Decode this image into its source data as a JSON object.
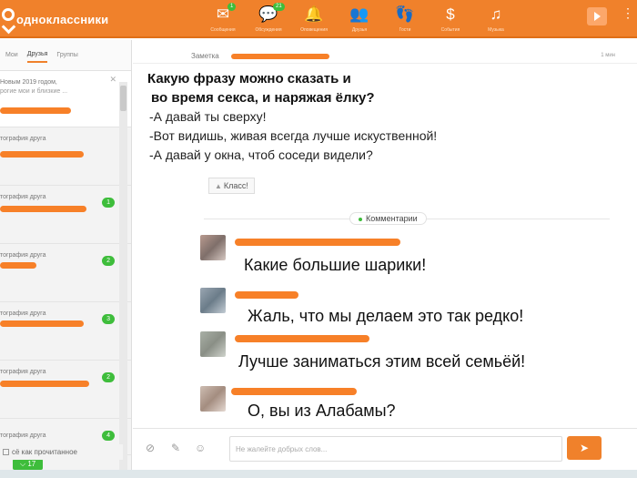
{
  "app": {
    "logo_text": "одноклассники"
  },
  "nav": [
    {
      "label": "Сообщения",
      "icon": "✉",
      "badge": "1"
    },
    {
      "label": "Обсуждения",
      "icon": "💬",
      "badge": "21"
    },
    {
      "label": "Оповещения",
      "icon": "🔔",
      "badge": ""
    },
    {
      "label": "Друзья",
      "icon": "👥",
      "badge": ""
    },
    {
      "label": "Гости",
      "icon": "👣",
      "badge": ""
    },
    {
      "label": "События",
      "icon": "$",
      "badge": ""
    },
    {
      "label": "Музыка",
      "icon": "♫",
      "badge": ""
    }
  ],
  "sidebar": {
    "tabs": [
      "Мои",
      "Друзья",
      "Группы"
    ],
    "items": [
      {
        "title": "Новым 2019 годом,",
        "sub": "рогие мои и близкие ...",
        "badge": ""
      },
      {
        "title": "тография друга",
        "sub": "",
        "badge": ""
      },
      {
        "title": "тография друга",
        "sub": "",
        "badge": "1"
      },
      {
        "title": "тография друга",
        "sub": "",
        "badge": "2"
      },
      {
        "title": "тография друга",
        "sub": "",
        "badge": "3"
      },
      {
        "title": "тография друга",
        "sub": "",
        "badge": "2"
      },
      {
        "title": "тография друга",
        "sub": "",
        "badge": "4"
      }
    ],
    "unread_label": "17",
    "footer_label": "сё как прочитанное"
  },
  "note": {
    "label": "Заметка",
    "time": "1 мин"
  },
  "post": {
    "title_line1": "Какую фразу можно сказать и",
    "title_line2": "во время секса, и наряжая ёлку?",
    "lines": [
      "-А давай ты сверху!",
      "-Вот видишь, живая всегда лучше искуственной!",
      "-А давай у окна, чтоб соседи видели?"
    ],
    "klass_label": "Класс!"
  },
  "comments_label": "Комментарии",
  "comments": [
    {
      "text": "Какие большие шарики!"
    },
    {
      "text": "Жаль, что мы делаем это так редко!"
    },
    {
      "text": "Лучше заниматься этим всей семьёй!"
    },
    {
      "text": "О, вы из Алабамы?"
    }
  ],
  "composer": {
    "placeholder": "Не жалейте добрых слов..."
  },
  "colors": {
    "accent": "#f0812b",
    "badge_green": "#3ebd3b",
    "smear": "#f7791c"
  }
}
